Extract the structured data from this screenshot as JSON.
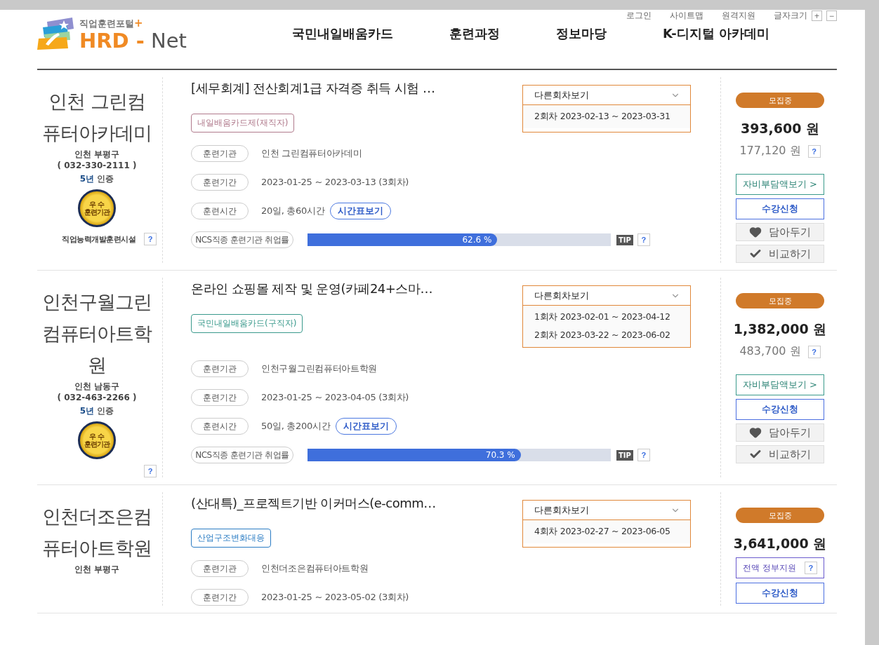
{
  "utility_links": [
    "로그인",
    "사이트맵",
    "원격지원",
    "글자크기"
  ],
  "font_size_buttons": [
    "+",
    "−"
  ],
  "logo": {
    "tagline": "직업훈련포털",
    "tagline_mark": "+",
    "name_main": "HRD",
    "name_dash": "-",
    "name_suffix": "Net"
  },
  "nav": [
    "국민내일배움카드",
    "훈련과정",
    "정보마당",
    "K-디지털 아카데미"
  ],
  "cards": [
    {
      "org": {
        "name": "인천 그린컴퓨터아카데미",
        "region": "인천 부평구",
        "phone": "( 032-330-2111 )",
        "cert": "**5년** 인증",
        "medal": [
          "우 수",
          "훈련기관"
        ],
        "facility": "직업능력개발훈련시설",
        "help": "?"
      },
      "title": "[세무회계] 전산회계1급 자격증 취득 시험 …",
      "tag": {
        "text": "내일배움카드제(재직자)",
        "color": "#b07a8c"
      },
      "info": [
        {
          "label": "훈련기관",
          "value": "인천 그린컴퓨터아카데미"
        },
        {
          "label": "훈련기간",
          "value": "2023-01-25 ~ 2023-03-13 (3회차)"
        },
        {
          "label": "훈련시간",
          "value": "20일, 총60시간",
          "button": "시간표보기"
        }
      ],
      "ncs": {
        "label": "NCS직종 훈련기관 취업률",
        "level": 0.626,
        "reading": "62.6 %",
        "tip": "TIP",
        "help": "?"
      },
      "rounds": {
        "label": "다른회차보기",
        "items": [
          "2회차 2023-02-13 ~ 2023-03-31"
        ]
      },
      "status": "모집중",
      "price": "393,600 원",
      "subsidy": {
        "kind": "price",
        "text": "177,120 원",
        "help": "?"
      },
      "actions": [
        {
          "kind": "self-pay",
          "label": "자비부담액보기 >"
        },
        {
          "kind": "apply",
          "label": "수강신청"
        },
        {
          "kind": "wish",
          "label": "담아두기"
        },
        {
          "kind": "compare",
          "label": "비교하기"
        }
      ]
    },
    {
      "org": {
        "name": "인천구월그린컴퓨터아트학원",
        "region": "인천 남동구",
        "phone": "( 032-463-2266 )",
        "cert": "**5년** 인증",
        "medal": [
          "우 수",
          "훈련기관"
        ],
        "help": "?"
      },
      "title": "온라인 쇼핑몰 제작 및 운영(카페24+스마…",
      "tag": {
        "text": "국민내일배움카드(구직자)",
        "color": "#3a9a8c"
      },
      "info": [
        {
          "label": "훈련기관",
          "value": "인천구월그린컴퓨터아트학원"
        },
        {
          "label": "훈련기간",
          "value": "2023-01-25 ~ 2023-04-05 (3회차)"
        },
        {
          "label": "훈련시간",
          "value": "50일, 총200시간",
          "button": "시간표보기"
        }
      ],
      "ncs": {
        "label": "NCS직종 훈련기관 취업률",
        "level": 0.703,
        "reading": "70.3 %",
        "tip": "TIP",
        "help": "?"
      },
      "rounds": {
        "label": "다른회차보기",
        "items": [
          "1회차 2023-02-01 ~ 2023-04-12",
          "2회차 2023-03-22 ~ 2023-06-02"
        ]
      },
      "status": "모집중",
      "price": "1,382,000 원",
      "subsidy": {
        "kind": "price",
        "text": "483,700 원",
        "help": "?"
      },
      "actions": [
        {
          "kind": "self-pay",
          "label": "자비부담액보기 >"
        },
        {
          "kind": "apply",
          "label": "수강신청"
        },
        {
          "kind": "wish",
          "label": "담아두기"
        },
        {
          "kind": "compare",
          "label": "비교하기"
        }
      ]
    },
    {
      "org": {
        "name": "인천더조은컴퓨터아트학원",
        "region": "인천 부평구"
      },
      "title": "(산대특)_프로젝트기반 이커머스(e-comm…",
      "tag": {
        "text": "산업구조변화대응",
        "color": "#2a7cc4"
      },
      "info": [
        {
          "label": "훈련기관",
          "value": "인천더조은컴퓨터아트학원"
        },
        {
          "label": "훈련기간",
          "value": "2023-01-25 ~ 2023-05-02 (3회차)"
        }
      ],
      "rounds": {
        "label": "다른회차보기",
        "items": [
          "4회차 2023-02-27 ~ 2023-06-05"
        ]
      },
      "status": "모집중",
      "price": "3,641,000 원",
      "subsidy": {
        "kind": "box",
        "text": "전액 정부지원",
        "help": "?"
      },
      "actions": [
        {
          "kind": "apply",
          "label": "수강신청"
        }
      ]
    }
  ]
}
